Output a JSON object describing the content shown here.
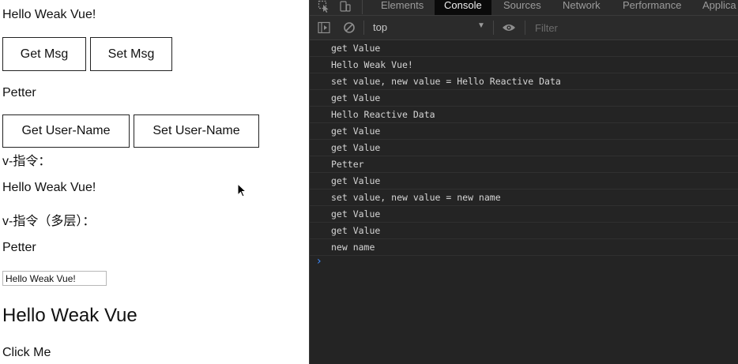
{
  "page": {
    "text_msg_1": "Hello Weak Vue!",
    "get_msg_button": "Get Msg",
    "set_msg_button": "Set Msg",
    "user_name": "Petter",
    "get_user_button": "Get User-Name",
    "set_user_button": "Set User-Name",
    "directive_label": "v-指令：",
    "directive_msg": "Hello Weak Vue!",
    "directive_multi_label": "v-指令（多层）：",
    "directive_multi_name": "Petter",
    "input_value": "Hello Weak Vue!",
    "heading": "Hello Weak Vue",
    "click_me": "Click Me"
  },
  "devtools": {
    "tabs": [
      "Elements",
      "Console",
      "Sources",
      "Network",
      "Performance",
      "Applica"
    ],
    "active_tab": "Console",
    "context": "top",
    "filter_placeholder": "Filter",
    "accent_color": "#3d8bff",
    "icons": [
      "inspect-element-icon",
      "device-toolbar-icon",
      "sidebar-toggle-icon",
      "clear-console-icon",
      "dropdown-arrow-icon",
      "eye-icon",
      "prompt-chevron-icon"
    ],
    "logs": [
      "get Value",
      "Hello Weak Vue!",
      "set value, new value = Hello Reactive Data",
      "get Value",
      "Hello Reactive Data",
      "get Value",
      "get Value",
      "Petter",
      "get Value",
      "set value, new value = new name",
      "get Value",
      "get Value",
      "new name"
    ]
  }
}
